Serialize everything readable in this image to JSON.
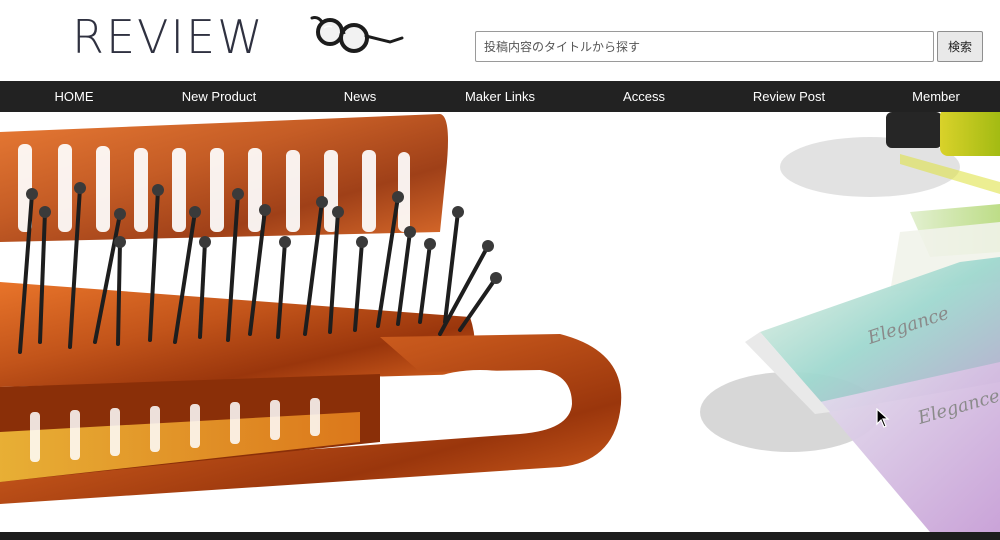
{
  "header": {
    "logo_text": "REVIEW",
    "logo_icon": "glasses-icon"
  },
  "search": {
    "placeholder": "投稿内容のタイトルから探す",
    "button_label": "検索"
  },
  "nav": {
    "items": [
      {
        "label": "HOME"
      },
      {
        "label": "New Product"
      },
      {
        "label": "News"
      },
      {
        "label": "Maker Links"
      },
      {
        "label": "Access"
      },
      {
        "label": "Review Post"
      },
      {
        "label": "Member"
      }
    ]
  },
  "hero": {
    "envelope_text_1": "Elegance",
    "envelope_text_2": "Elegance"
  },
  "colors": {
    "nav_bg": "#222222",
    "logo": "#2f3140",
    "tortoise": "#c2541a",
    "tortoise_dark": "#7a2a08"
  }
}
